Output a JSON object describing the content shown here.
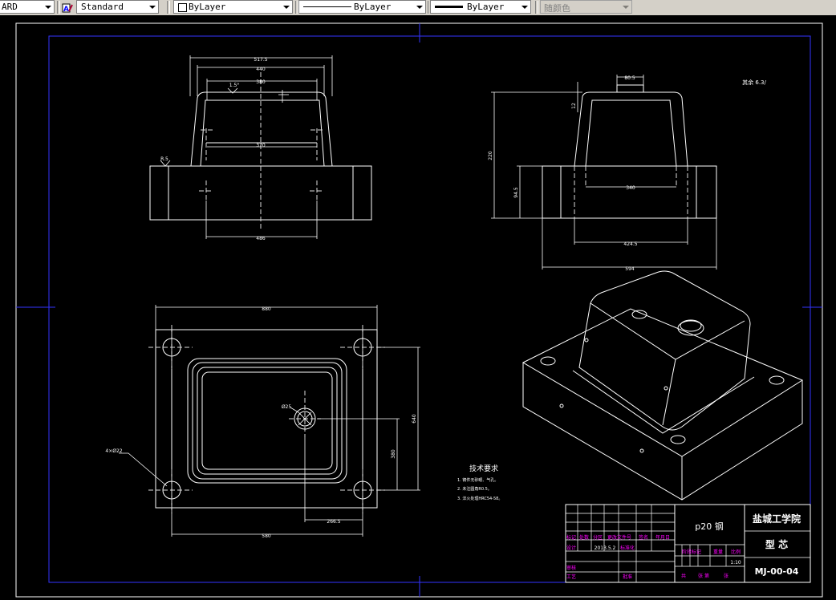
{
  "toolbar": {
    "dim_style": "ARD",
    "text_style": "Standard",
    "layer": "ByLayer",
    "linetype": "ByLayer",
    "lineweight": "ByLayer",
    "plot_color": "随颜色"
  },
  "views": {
    "front": {
      "dim_top": "517.5",
      "dim_mid": "440",
      "dim_inner": "380",
      "dim_taper": "1.5°",
      "dim_base_inner": "370",
      "dim_chamfer": "R.5",
      "dim_flange": "486"
    },
    "side": {
      "dim_top": "80.5",
      "dim_side": "220",
      "dim_left": "94.5",
      "dim_step": "12",
      "dim_inner": "340",
      "dim_base": "424.5",
      "dim_bottom": "594"
    },
    "plan": {
      "dim_width": "880",
      "dim_height": "640",
      "dim_inner_h": "380",
      "dim_bottom": "580",
      "dim_offset": "266.5",
      "dim_hole": "4×Ø22",
      "dim_pin": "Ø25"
    },
    "roughness": "其余 6.3/"
  },
  "tech": {
    "title": "技术要求",
    "items": [
      "1. 铸件无砂眼、气孔。",
      "2. 未注圆角R0.5。",
      "3. 淬火处理HRC54-58。"
    ]
  },
  "title_block": {
    "material": "p20 钢",
    "school": "盐城工学院",
    "part_name": "型 芯",
    "drawing_no": "MJ-00-04",
    "scale": "1:10",
    "header_labels": [
      "标记",
      "处数",
      "分区",
      "更改文件号",
      "签名",
      "年月日"
    ],
    "design_label": "设计",
    "standard_label": "标准化",
    "std_date": "2013.5.2",
    "review_label": "审核",
    "process_label": "工艺",
    "approve_label": "批准",
    "stage_label": "阶段标记",
    "weight_label": "重量",
    "scale_label": "比例",
    "sheet_total": "共",
    "sheet_no": "张 第",
    "sheet_suffix": "张"
  }
}
